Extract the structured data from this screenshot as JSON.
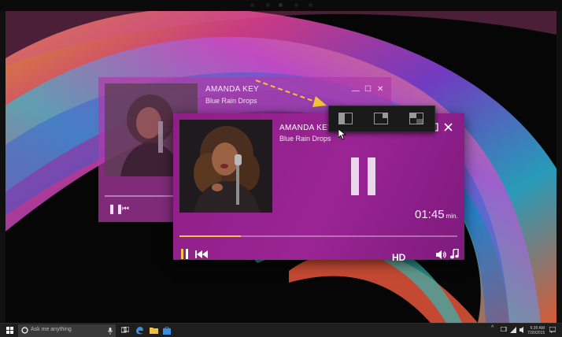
{
  "colors": {
    "accent": "#9a2494",
    "ghost_panel": "#b03aa8",
    "progress_fill": "#f4c74a",
    "snap_bg": "#1a1a1a",
    "taskbar_bg": "#1e1e1e"
  },
  "ghost_player": {
    "artist": "AMANDA KEY",
    "song": "Blue Rain Drops"
  },
  "player": {
    "artist": "AMANDA KEY",
    "song": "Blue Rain Drops",
    "time": "01:45",
    "time_unit": "min.",
    "quality": "HD",
    "progress": 0.22,
    "icons": [
      "minimize-icon",
      "maximize-icon",
      "close-icon",
      "pause-icon",
      "skip-back-icon",
      "volume-icon",
      "music-note-icon"
    ]
  },
  "snap_layouts": {
    "options": [
      "layout-left-right",
      "layout-main-side",
      "layout-grid"
    ]
  },
  "taskbar": {
    "search_placeholder": "Ask me anything",
    "clock_time": "6:30 AM",
    "clock_date": "7/30/2015",
    "icons": [
      "windows-start-icon",
      "cortana-icon",
      "microphone-icon",
      "task-view-icon",
      "edge-icon",
      "file-explorer-icon",
      "store-icon",
      "chevron-up-icon",
      "network-icon",
      "volume-icon",
      "notification-icon"
    ]
  }
}
